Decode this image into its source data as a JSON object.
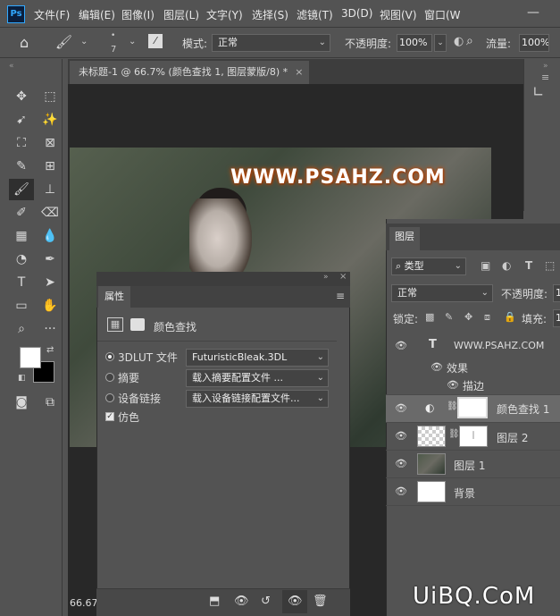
{
  "app": {
    "logo": "Ps"
  },
  "menu": [
    "文件(F)",
    "编辑(E)",
    "图像(I)",
    "图层(L)",
    "文字(Y)",
    "选择(S)",
    "滤镜(T)",
    "3D(D)",
    "视图(V)",
    "窗口(W"
  ],
  "options": {
    "brush_size": "7",
    "mode_label": "模式:",
    "mode_value": "正常",
    "opacity_label": "不透明度:",
    "opacity_value": "100%",
    "flow_label": "流量:",
    "flow_value": "100%"
  },
  "document": {
    "tab_title": "未标题-1 @ 66.7% (颜色查找 1, 图层蒙版/8) *",
    "zoom_status": "66.67",
    "watermark": "WWW.PSAHZ.COM"
  },
  "properties": {
    "tab": "属性",
    "header": "颜色查找",
    "rows": [
      {
        "label": "3DLUT 文件",
        "value": "FuturisticBleak.3DL",
        "selected": true
      },
      {
        "label": "摘要",
        "value": "载入摘要配置文件 ...",
        "selected": false
      },
      {
        "label": "设备链接",
        "value": "载入设备链接配置文件...",
        "selected": false
      }
    ],
    "dither_label": "仿色",
    "dither_checked": true
  },
  "layers": {
    "tab": "图层",
    "filter_label": "类型",
    "blend_mode": "正常",
    "opacity_label": "不透明度:",
    "opacity_value": "1",
    "lock_label": "锁定:",
    "fill_label": "填充:",
    "fill_value": "1",
    "items": [
      {
        "name": "WWW.PSAHZ.COM",
        "kind": "text"
      },
      {
        "name": "效果",
        "kind": "effects"
      },
      {
        "name": "描边",
        "kind": "effect"
      },
      {
        "name": "颜色查找 1",
        "kind": "adjustment"
      },
      {
        "name": "图层 2",
        "kind": "masked"
      },
      {
        "name": "图层 1",
        "kind": "photo"
      },
      {
        "name": "背景",
        "kind": "background"
      }
    ]
  },
  "brand": "UiBQ.CoM"
}
